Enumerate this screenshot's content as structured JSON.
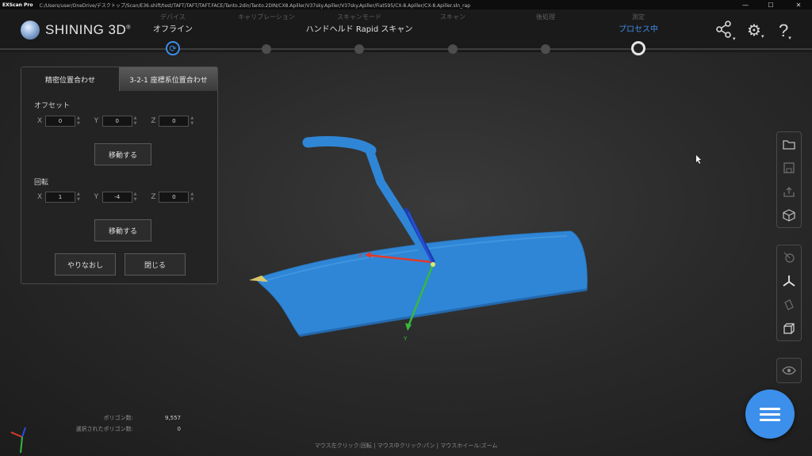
{
  "titlebar": {
    "app_name": "EXScan Pro",
    "path": "C:/Users/user/OneDrive/デスクトップ/Scan/E36.shift/test/TAFT/TAFT/TAFT.FACE/Tanto.2din/Tanto.2DIN/CX8.Apiller/V37sky.Apiller/V37sky.Apiller/Fiat595/CX-8.Apiller/CX-8.Apiller.sln_rap",
    "minimize": "—",
    "maximize": "☐",
    "close": "✕"
  },
  "header": {
    "brand": "SHINING 3D",
    "brand_mark": "®",
    "steps": [
      {
        "sub": "デバイス",
        "main": "オフライン"
      },
      {
        "sub": "キャリブレーション",
        "main": ""
      },
      {
        "sub": "スキャンモード",
        "main": "ハンドヘルド Rapid スキャン"
      },
      {
        "sub": "スキャン",
        "main": ""
      },
      {
        "sub": "後処理",
        "main": ""
      },
      {
        "sub": "測定",
        "main": "プロセス中"
      }
    ],
    "refresh_glyph": "⟳",
    "share_glyph": "⊲",
    "settings_glyph": "⚙",
    "help_glyph": "?"
  },
  "panel": {
    "tab_active": "精密位置合わせ",
    "tab_inactive": "3-2-1 座標系位置合わせ",
    "offset_title": "オフセット",
    "offset": {
      "x_label": "X",
      "x": "0",
      "y_label": "Y",
      "y": "0",
      "z_label": "Z",
      "z": "0"
    },
    "move_label_1": "移動する",
    "rotation_title": "回転",
    "rotation": {
      "x_label": "X",
      "x": "1",
      "y_label": "Y",
      "y": "-4",
      "z_label": "Z",
      "z": "0"
    },
    "move_label_2": "移動する",
    "redo_label": "やりなおし",
    "close_label": "閉じる"
  },
  "axes": {
    "x_label": "X",
    "y_label": "Y"
  },
  "stats": {
    "polygon_label": "ポリゴン数:",
    "polygon_value": "9,557",
    "selected_label": "選択されたポリゴン数:",
    "selected_value": "0"
  },
  "statusbar": {
    "hint": "マウス左クリック:回転 | マウス中クリック:パン | マウスホイール:ズーム"
  },
  "colors": {
    "accent": "#3e8ee8",
    "mesh": "#2f86d6",
    "axis_x": "#e03a2a",
    "axis_y": "#38b83c",
    "axis_z": "#2a4fd6"
  },
  "icons": {
    "toolbar1": [
      "folder-icon",
      "save-icon",
      "export-icon",
      "cube-icon"
    ],
    "toolbar2": [
      "mesh-view-icon",
      "axis-icon",
      "texture-icon",
      "wireframe-box-icon"
    ],
    "toolbar3": [
      "eye-icon"
    ]
  }
}
